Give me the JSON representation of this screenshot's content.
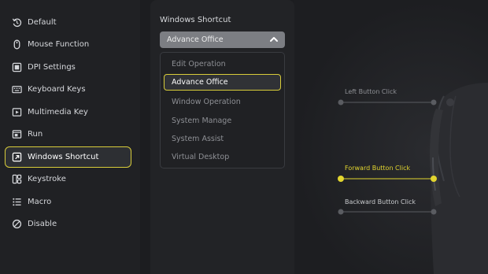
{
  "sidebar": {
    "items": [
      {
        "label": "Default",
        "icon": "reset-icon"
      },
      {
        "label": "Mouse Function",
        "icon": "mouse-icon"
      },
      {
        "label": "DPI Settings",
        "icon": "dpi-icon"
      },
      {
        "label": "Keyboard Keys",
        "icon": "keyboard-icon"
      },
      {
        "label": "Multimedia Key",
        "icon": "multimedia-icon"
      },
      {
        "label": "Run",
        "icon": "run-icon"
      },
      {
        "label": "Windows Shortcut",
        "icon": "shortcut-icon",
        "active": true
      },
      {
        "label": "Keystroke",
        "icon": "keystroke-icon"
      },
      {
        "label": "Macro",
        "icon": "macro-icon"
      },
      {
        "label": "Disable",
        "icon": "disable-icon"
      }
    ]
  },
  "shortcut_panel": {
    "title": "Windows Shortcut",
    "selected_value": "Advance Office",
    "options": [
      "Edit Operation",
      "Advance Office",
      "Window Operation",
      "System Manage",
      "System Assist",
      "Virtual Desktop"
    ]
  },
  "callouts": {
    "left_button": "Left Button Click",
    "forward_button": "Forward Button Click",
    "backward_button": "Backward Button Click"
  },
  "colors": {
    "accent": "#e2d52f",
    "inactive_line": "#5a5c61"
  }
}
